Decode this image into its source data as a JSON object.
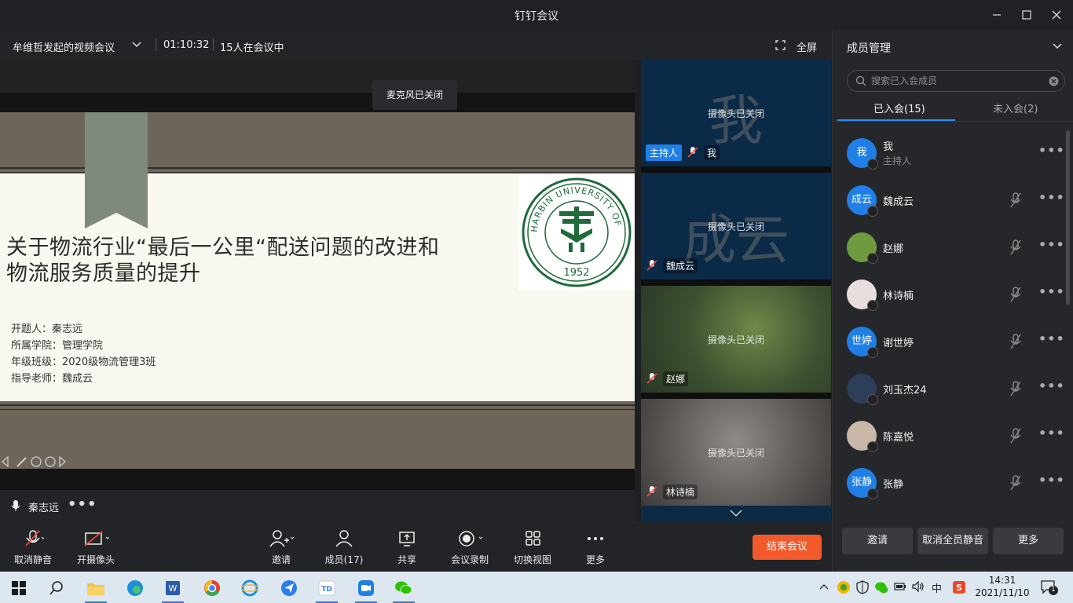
{
  "window": {
    "title": "钉钉会议"
  },
  "meeting": {
    "name": "牟维哲发起的视频会议",
    "duration": "01:10:32",
    "participants_text": "15人在会议中",
    "fullscreen_label": "全屏"
  },
  "toast": "麦克风已关闭",
  "slide": {
    "title_line1": "关于物流行业“最后一公里“配送问题的改进和",
    "title_line2": "物流服务质量的提升",
    "meta": [
      "开题人：秦志远",
      "所属学院：管理学院",
      "年级班级：2020级物流管理3班",
      "指导老师：魏成云"
    ],
    "logo_text": "HARBIN UNIVERSITY OF COMMERCE",
    "logo_year": "1952"
  },
  "speaker": {
    "name": "秦志远"
  },
  "videos": [
    {
      "big": "我",
      "status": "摄像头已关闭",
      "badge": "主持人",
      "name": "我"
    },
    {
      "big": "成云",
      "status": "摄像头已关闭",
      "name": "魏成云"
    },
    {
      "big": "",
      "status": "摄像头已关闭",
      "name": "赵娜"
    },
    {
      "big": "",
      "status": "摄像头已关闭",
      "name": "林诗楠"
    }
  ],
  "panel": {
    "title": "成员管理",
    "search_placeholder": "搜索已入会成员",
    "tab_joined": "已入会(15)",
    "tab_not_joined": "未入会(2)",
    "members": [
      {
        "avatar": "我",
        "name": "我",
        "sub": "主持人",
        "color": "#1f7fe6"
      },
      {
        "avatar": "成云",
        "name": "魏成云",
        "color": "#1f7fe6"
      },
      {
        "avatar": "",
        "name": "赵娜",
        "color": "#6f9a3f"
      },
      {
        "avatar": "",
        "name": "林诗楠",
        "color": "#e9dede"
      },
      {
        "avatar": "世婷",
        "name": "谢世婷",
        "color": "#1f7fe6"
      },
      {
        "avatar": "",
        "name": "刘玉杰24",
        "color": "#2c3e5a"
      },
      {
        "avatar": "",
        "name": "陈嘉悦",
        "color": "#c9b8a8"
      },
      {
        "avatar": "张静",
        "name": "张静",
        "color": "#1f7fe6"
      }
    ],
    "buttons": [
      "邀请",
      "取消全员静音",
      "更多"
    ]
  },
  "toolbar": {
    "mute": "取消静音",
    "camera": "开摄像头",
    "invite": "邀请",
    "members": "成员(17)",
    "share": "共享",
    "record": "会议录制",
    "switch_view": "切换视图",
    "more": "更多",
    "end": "结束会议"
  },
  "taskbar": {
    "time": "14:31",
    "date": "2021/11/10",
    "ime": "中",
    "notif_count": "1"
  },
  "colors": {
    "accent": "#2e8cf0",
    "end_button": "#f25a2c",
    "host_badge": "#1f7fe6"
  }
}
